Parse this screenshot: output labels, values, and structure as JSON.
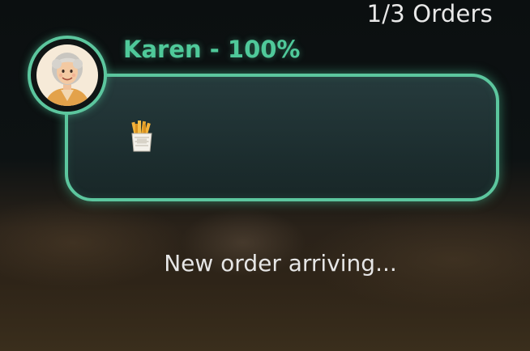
{
  "hud": {
    "orders_counter": "1/3 Orders"
  },
  "customer": {
    "name_label": "Karen - 100%",
    "avatar_icon": "elderly-woman-avatar-icon"
  },
  "order": {
    "items": [
      {
        "icon": "french-fries-icon"
      }
    ]
  },
  "status": {
    "message": "New order arriving..."
  },
  "colors": {
    "accent": "#5cc69e",
    "name_text": "#4fc99a",
    "text": "#e8e8e8"
  }
}
